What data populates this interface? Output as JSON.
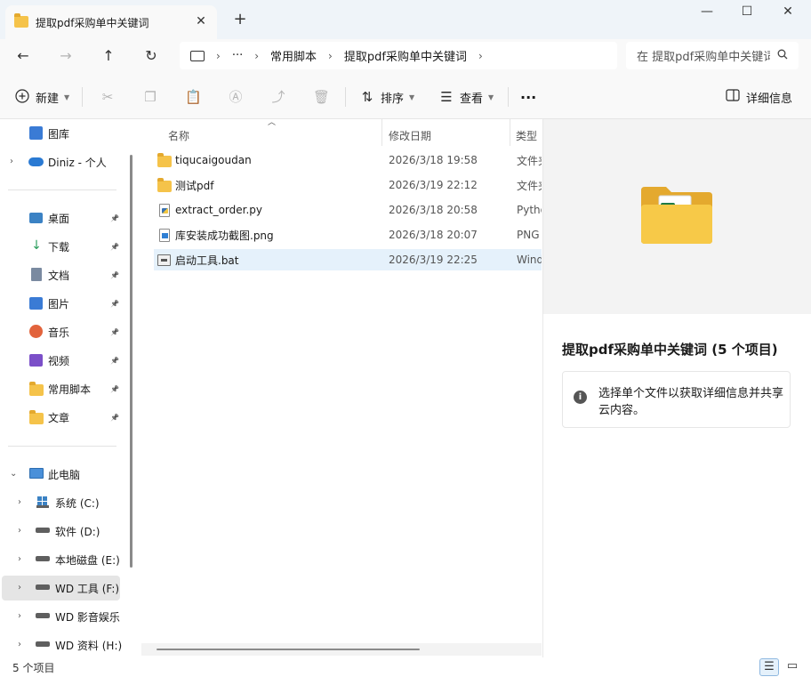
{
  "tab": {
    "title": "提取pdf采购单中关键词",
    "close": "✕"
  },
  "window": {
    "newtab": "+",
    "minimize": "—",
    "maximize": "☐",
    "close": "✕"
  },
  "nav": {
    "back": "←",
    "forward": "→",
    "up": "↑",
    "refresh": "↻",
    "address": {
      "more": "···",
      "segments": [
        "常用脚本",
        "提取pdf采购单中关键词"
      ]
    },
    "search_placeholder": "在 提取pdf采购单中关键词 中搜索"
  },
  "toolbar": {
    "new_label": "新建",
    "sort_label": "排序",
    "view_label": "查看",
    "more": "···",
    "details_label": "详细信息"
  },
  "sidebar": {
    "gallery": "图库",
    "onedrive": "Diniz - 个人",
    "quick": [
      {
        "label": "桌面",
        "icon": "desktop-icon"
      },
      {
        "label": "下载",
        "icon": "download-icon"
      },
      {
        "label": "文档",
        "icon": "document-icon"
      },
      {
        "label": "图片",
        "icon": "pictures-icon"
      },
      {
        "label": "音乐",
        "icon": "music-icon"
      },
      {
        "label": "视频",
        "icon": "video-icon"
      },
      {
        "label": "常用脚本",
        "icon": "folder-icon"
      },
      {
        "label": "文章",
        "icon": "folder-icon"
      }
    ],
    "this_pc": "此电脑",
    "drives": [
      {
        "label": "系统 (C:)"
      },
      {
        "label": "软件 (D:)"
      },
      {
        "label": "本地磁盘 (E:)"
      },
      {
        "label": "WD 工具 (F:)",
        "selected": true
      },
      {
        "label": "WD 影音娱乐"
      },
      {
        "label": "WD 资料 (H:)"
      }
    ]
  },
  "columns": {
    "name": "名称",
    "modified": "修改日期",
    "type": "类型"
  },
  "files": [
    {
      "name": "tiqucaigoudan",
      "date": "2026/3/18 19:58",
      "type": "文件夹",
      "kind": "folder"
    },
    {
      "name": "测试pdf",
      "date": "2026/3/19 22:12",
      "type": "文件夹",
      "kind": "folder"
    },
    {
      "name": "extract_order.py",
      "date": "2026/3/18 20:58",
      "type": "Python",
      "kind": "py"
    },
    {
      "name": "库安装成功截图.png",
      "date": "2026/3/18 20:07",
      "type": "PNG",
      "kind": "png"
    },
    {
      "name": "启动工具.bat",
      "date": "2026/3/19 22:25",
      "type": "Windows",
      "kind": "bat"
    }
  ],
  "details": {
    "title": "提取pdf采购单中关键词 (5 个项目)",
    "info": "选择单个文件以获取详细信息并共享云内容。"
  },
  "status": {
    "count": "5 个项目"
  },
  "colors": {
    "accent": "#0067c0",
    "folder": "#f5c34a",
    "hover": "#e5f1fb"
  }
}
